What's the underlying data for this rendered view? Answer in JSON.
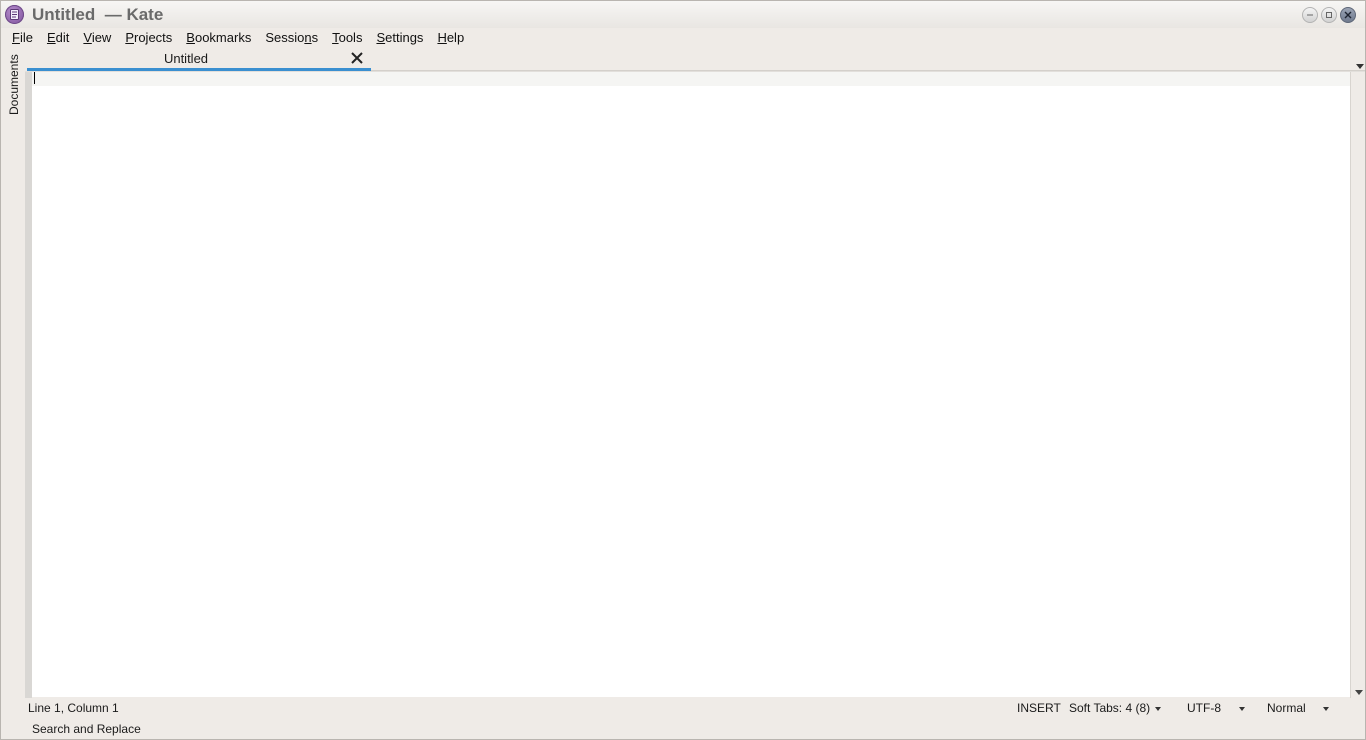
{
  "window": {
    "title": "Untitled  — Kate",
    "app_icon": "kate-app-icon",
    "controls": [
      "minimize",
      "maximize",
      "close"
    ]
  },
  "menubar": {
    "items": [
      {
        "label": "File",
        "mnemonic": "F"
      },
      {
        "label": "Edit",
        "mnemonic": "E"
      },
      {
        "label": "View",
        "mnemonic": "V"
      },
      {
        "label": "Projects",
        "mnemonic": "P"
      },
      {
        "label": "Bookmarks",
        "mnemonic": "B"
      },
      {
        "label": "Sessions",
        "mnemonic": "n"
      },
      {
        "label": "Tools",
        "mnemonic": "T"
      },
      {
        "label": "Settings",
        "mnemonic": "S"
      },
      {
        "label": "Help",
        "mnemonic": "H"
      }
    ]
  },
  "sidebar": {
    "tab_label": "Documents"
  },
  "tabs": [
    {
      "label": "Untitled",
      "active": true
    }
  ],
  "editor": {
    "content": "",
    "accent_color": "#3a8fd0"
  },
  "statusbar": {
    "cursor_position": "Line 1, Column 1",
    "input_mode": "INSERT",
    "indentation": "Soft Tabs: 4 (8)",
    "encoding": "UTF-8",
    "highlighting": "Normal"
  },
  "bottom_panel": {
    "tab_label": "Search and Replace"
  }
}
